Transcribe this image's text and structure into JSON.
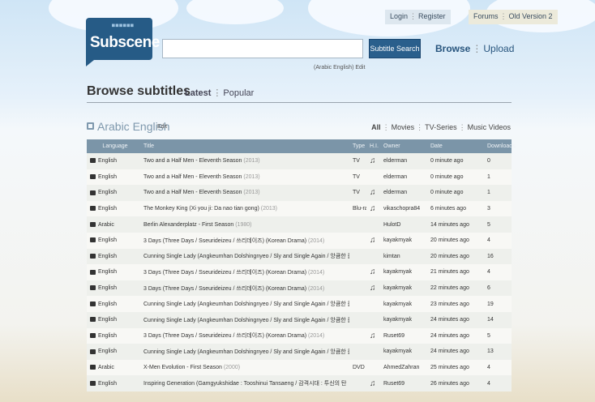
{
  "logo": {
    "text": "Subscene",
    "dots": "■■■■■■"
  },
  "topnav": {
    "login": "Login",
    "register": "Register",
    "forums": "Forums",
    "old_version": "Old Version 2"
  },
  "search": {
    "value": "",
    "button": "Subtitle Search",
    "lang_hint": "(Arabic English) Edit"
  },
  "browse_links": {
    "browse": "Browse",
    "upload": "Upload"
  },
  "page_title": "Browse subtitles",
  "tabs": {
    "latest": "Latest",
    "popular": "Popular"
  },
  "section": {
    "title": "Arabic English",
    "edit": "Edit"
  },
  "filters": {
    "all": "All",
    "movies": "Movies",
    "tv": "TV-Series",
    "music": "Music Videos"
  },
  "columns": [
    "Language",
    "Title",
    "Type",
    "H.I.",
    "Owner",
    "Date",
    "Downloads"
  ],
  "rows": [
    {
      "lang": "English",
      "title": "Two and a Half Men - Eleventh Season",
      "year": "(2013)",
      "type": "TV",
      "hi": "♫",
      "owner": "elderman",
      "date": "0 minute ago",
      "dl": "0"
    },
    {
      "lang": "English",
      "title": "Two and a Half Men - Eleventh Season",
      "year": "(2013)",
      "type": "TV",
      "hi": "",
      "owner": "elderman",
      "date": "0 minute ago",
      "dl": "1"
    },
    {
      "lang": "English",
      "title": "Two and a Half Men - Eleventh Season",
      "year": "(2013)",
      "type": "TV",
      "hi": "♫",
      "owner": "elderman",
      "date": "0 minute ago",
      "dl": "1"
    },
    {
      "lang": "English",
      "title": "The Monkey King (Xi you ji: Da nao tian gong)",
      "year": "(2013)",
      "type": "Blu-ray",
      "hi": "♫",
      "owner": "vikaschopra84",
      "date": "6 minutes ago",
      "dl": "3"
    },
    {
      "lang": "Arabic",
      "title": "Berlin Alexanderplatz - First Season",
      "year": "(1980)",
      "type": "",
      "hi": "",
      "owner": "HulotD",
      "date": "14 minutes ago",
      "dl": "5"
    },
    {
      "lang": "English",
      "title": "3 Days (Three Days / Sseurideizeu / 쓰리데이즈) (Korean Drama)",
      "year": "(2014)",
      "type": "",
      "hi": "♫",
      "owner": "kayakmyak",
      "date": "20 minutes ago",
      "dl": "4"
    },
    {
      "lang": "English",
      "title": "Cunning Single Lady (Angkeumhan Dolshingnyeo / Sly and Single Again / 앙큼한 돌",
      "year": "",
      "type": "",
      "hi": "",
      "owner": "kimtan",
      "date": "20 minutes ago",
      "dl": "16"
    },
    {
      "lang": "English",
      "title": "3 Days (Three Days / Sseurideizeu / 쓰리데이즈) (Korean Drama)",
      "year": "(2014)",
      "type": "",
      "hi": "♫",
      "owner": "kayakmyak",
      "date": "21 minutes ago",
      "dl": "4"
    },
    {
      "lang": "English",
      "title": "3 Days (Three Days / Sseurideizeu / 쓰리데이즈) (Korean Drama)",
      "year": "(2014)",
      "type": "",
      "hi": "♫",
      "owner": "kayakmyak",
      "date": "22 minutes ago",
      "dl": "6"
    },
    {
      "lang": "English",
      "title": "Cunning Single Lady (Angkeumhan Dolshingnyeo / Sly and Single Again / 앙큼한 돌",
      "year": "",
      "type": "",
      "hi": "",
      "owner": "kayakmyak",
      "date": "23 minutes ago",
      "dl": "19"
    },
    {
      "lang": "English",
      "title": "Cunning Single Lady (Angkeumhan Dolshingnyeo / Sly and Single Again / 앙큼한 돌",
      "year": "",
      "type": "",
      "hi": "",
      "owner": "kayakmyak",
      "date": "24 minutes ago",
      "dl": "14"
    },
    {
      "lang": "English",
      "title": "3 Days (Three Days / Sseurideizeu / 쓰리데이즈) (Korean Drama)",
      "year": "(2014)",
      "type": "",
      "hi": "♫",
      "owner": "Ruset69",
      "date": "24 minutes ago",
      "dl": "5"
    },
    {
      "lang": "English",
      "title": "Cunning Single Lady (Angkeumhan Dolshingnyeo / Sly and Single Again / 앙큼한 돌",
      "year": "",
      "type": "",
      "hi": "",
      "owner": "kayakmyak",
      "date": "24 minutes ago",
      "dl": "13"
    },
    {
      "lang": "Arabic",
      "title": "X-Men Evolution - First Season",
      "year": "(2000)",
      "type": "DVD",
      "hi": "",
      "owner": "AhmedZahran",
      "date": "25 minutes ago",
      "dl": "4"
    },
    {
      "lang": "English",
      "title": "Inspiring Generation (Gamgyukshidae : Tooshinui Tansaeng / 감격시대 : 투신의 탄",
      "year": "",
      "type": "",
      "hi": "♫",
      "owner": "Ruset69",
      "date": "26 minutes ago",
      "dl": "4"
    }
  ]
}
